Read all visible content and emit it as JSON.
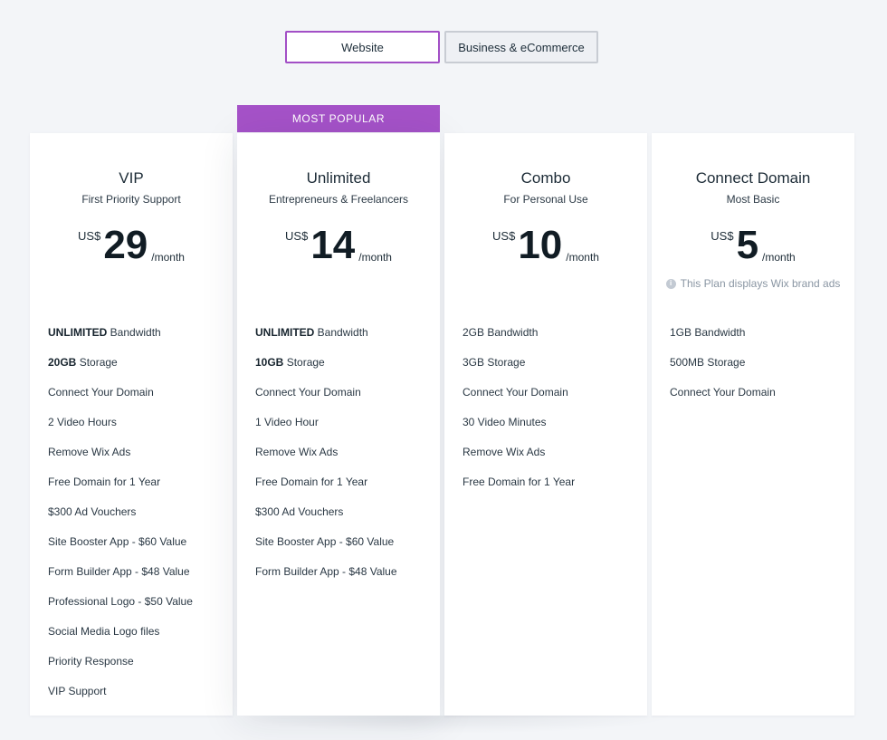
{
  "tabs": [
    {
      "label": "Website",
      "active": true
    },
    {
      "label": "Business & eCommerce",
      "active": false
    }
  ],
  "popular_banner": "MOST POPULAR",
  "plans": [
    {
      "name": "VIP",
      "subtitle": "First Priority Support",
      "currency": "US$",
      "amount": "29",
      "period": "/month",
      "features": [
        {
          "bold": "UNLIMITED",
          "text": " Bandwidth"
        },
        {
          "bold": "20GB",
          "text": " Storage"
        },
        {
          "bold": "",
          "text": "Connect Your Domain"
        },
        {
          "bold": "",
          "text": "2 Video Hours"
        },
        {
          "bold": "",
          "text": "Remove Wix Ads"
        },
        {
          "bold": "",
          "text": "Free Domain for 1 Year"
        },
        {
          "bold": "",
          "text": "$300 Ad Vouchers"
        },
        {
          "bold": "",
          "text": "Site Booster App - $60 Value"
        },
        {
          "bold": "",
          "text": "Form Builder App - $48 Value"
        },
        {
          "bold": "",
          "text": "Professional Logo - $50 Value"
        },
        {
          "bold": "",
          "text": "Social Media Logo files"
        },
        {
          "bold": "",
          "text": "Priority Response"
        },
        {
          "bold": "",
          "text": "VIP Support"
        }
      ]
    },
    {
      "name": "Unlimited",
      "subtitle": "Entrepreneurs & Freelancers",
      "currency": "US$",
      "amount": "14",
      "period": "/month",
      "features": [
        {
          "bold": "UNLIMITED",
          "text": " Bandwidth"
        },
        {
          "bold": "10GB",
          "text": " Storage"
        },
        {
          "bold": "",
          "text": "Connect Your Domain"
        },
        {
          "bold": "",
          "text": "1 Video Hour"
        },
        {
          "bold": "",
          "text": "Remove Wix Ads"
        },
        {
          "bold": "",
          "text": "Free Domain for 1 Year"
        },
        {
          "bold": "",
          "text": "$300 Ad Vouchers"
        },
        {
          "bold": "",
          "text": "Site Booster App - $60 Value"
        },
        {
          "bold": "",
          "text": "Form Builder App - $48 Value"
        }
      ]
    },
    {
      "name": "Combo",
      "subtitle": "For Personal Use",
      "currency": "US$",
      "amount": "10",
      "period": "/month",
      "features": [
        {
          "bold": "",
          "text": "2GB Bandwidth"
        },
        {
          "bold": "",
          "text": "3GB Storage"
        },
        {
          "bold": "",
          "text": "Connect Your Domain"
        },
        {
          "bold": "",
          "text": "30 Video Minutes"
        },
        {
          "bold": "",
          "text": "Remove Wix Ads"
        },
        {
          "bold": "",
          "text": "Free Domain for 1 Year"
        }
      ]
    },
    {
      "name": "Connect Domain",
      "subtitle": "Most Basic",
      "currency": "US$",
      "amount": "5",
      "period": "/month",
      "note": "This Plan displays Wix brand ads",
      "features": [
        {
          "bold": "",
          "text": "1GB Bandwidth"
        },
        {
          "bold": "",
          "text": "500MB Storage"
        },
        {
          "bold": "",
          "text": "Connect Your Domain"
        }
      ]
    }
  ],
  "colors": {
    "accent": "#a552c8",
    "background": "#f3f5f8"
  }
}
